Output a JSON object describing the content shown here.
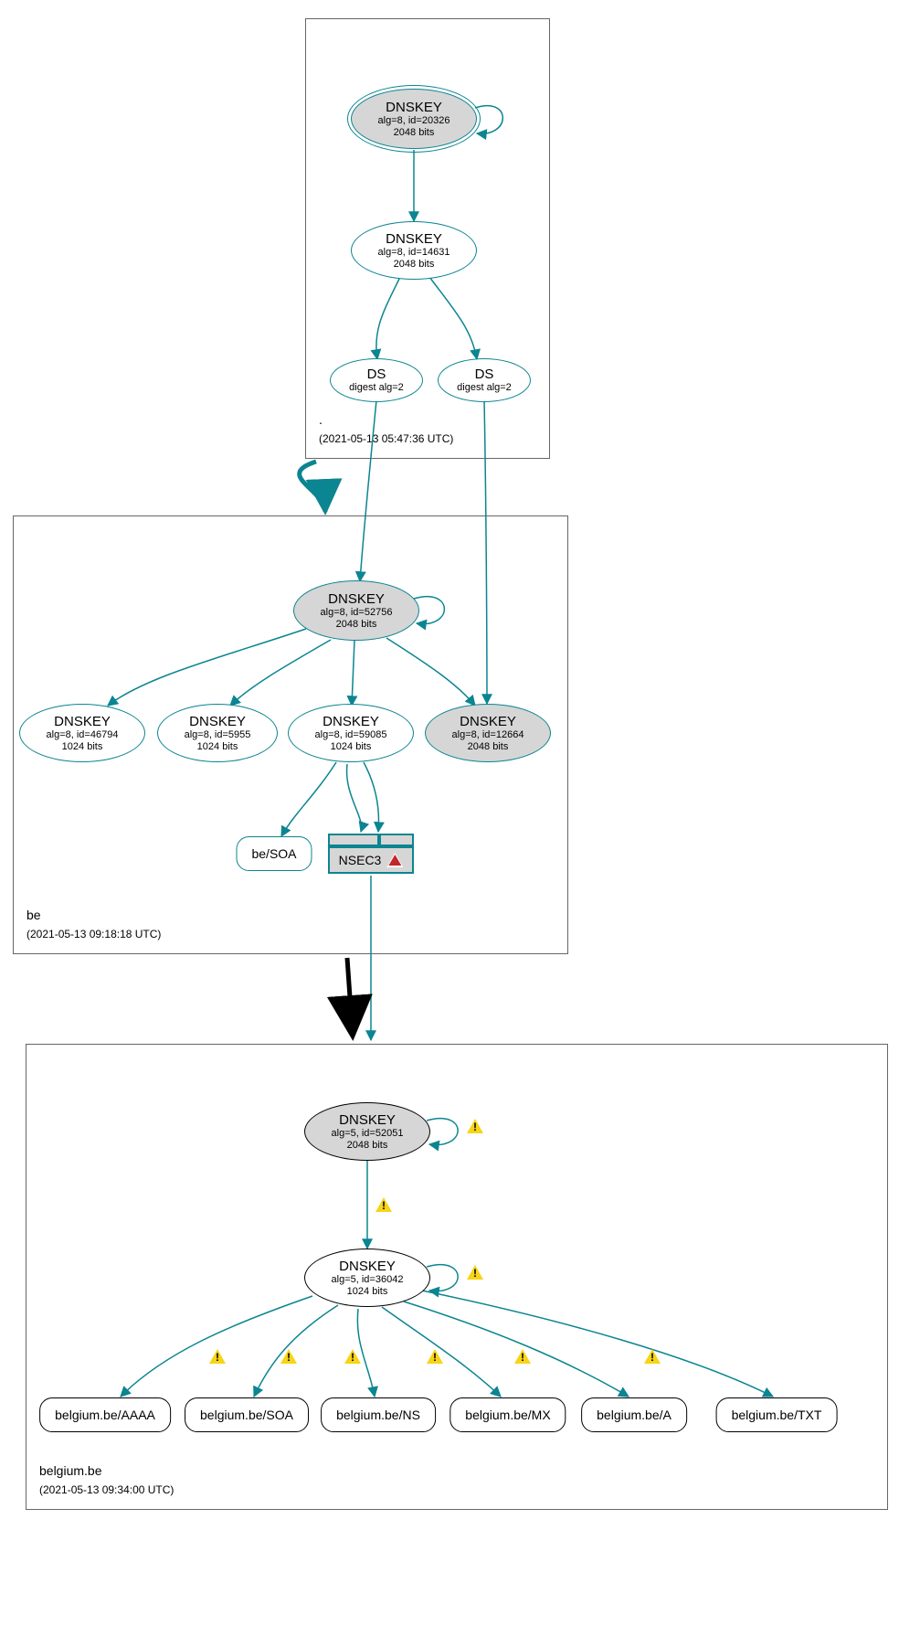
{
  "zones": {
    "root": {
      "label": ".",
      "timestamp": "(2021-05-13 05:47:36 UTC)"
    },
    "be": {
      "label": "be",
      "timestamp": "(2021-05-13 09:18:18 UTC)"
    },
    "belgium": {
      "label": "belgium.be",
      "timestamp": "(2021-05-13 09:34:00 UTC)"
    }
  },
  "nodes": {
    "root_ksk": {
      "title": "DNSKEY",
      "sub1": "alg=8, id=20326",
      "sub2": "2048 bits"
    },
    "root_zsk": {
      "title": "DNSKEY",
      "sub1": "alg=8, id=14631",
      "sub2": "2048 bits"
    },
    "ds_left": {
      "title": "DS",
      "sub1": "digest alg=2"
    },
    "ds_right": {
      "title": "DS",
      "sub1": "digest alg=2"
    },
    "be_ksk": {
      "title": "DNSKEY",
      "sub1": "alg=8, id=52756",
      "sub2": "2048 bits"
    },
    "be_zsk1": {
      "title": "DNSKEY",
      "sub1": "alg=8, id=46794",
      "sub2": "1024 bits"
    },
    "be_zsk2": {
      "title": "DNSKEY",
      "sub1": "alg=8, id=5955",
      "sub2": "1024 bits"
    },
    "be_zsk3": {
      "title": "DNSKEY",
      "sub1": "alg=8, id=59085",
      "sub2": "1024 bits"
    },
    "be_ksk2": {
      "title": "DNSKEY",
      "sub1": "alg=8, id=12664",
      "sub2": "2048 bits"
    },
    "be_soa": {
      "label": "be/SOA"
    },
    "nsec3": {
      "label": "NSEC3"
    },
    "blg_ksk": {
      "title": "DNSKEY",
      "sub1": "alg=5, id=52051",
      "sub2": "2048 bits"
    },
    "blg_zsk": {
      "title": "DNSKEY",
      "sub1": "alg=5, id=36042",
      "sub2": "1024 bits"
    },
    "rr_aaaa": {
      "label": "belgium.be/AAAA"
    },
    "rr_soa": {
      "label": "belgium.be/SOA"
    },
    "rr_ns": {
      "label": "belgium.be/NS"
    },
    "rr_mx": {
      "label": "belgium.be/MX"
    },
    "rr_a": {
      "label": "belgium.be/A"
    },
    "rr_txt": {
      "label": "belgium.be/TXT"
    }
  }
}
